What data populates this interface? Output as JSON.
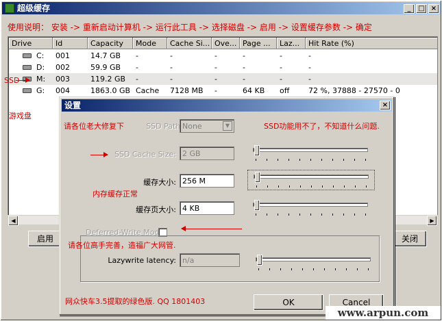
{
  "window": {
    "title": "超级缓存",
    "minimize_glyph": "_",
    "restore_glyph": "□",
    "close_glyph": "×"
  },
  "instruction": "使用说明： 安装 -> 重新启动计算机 -> 运行此工具 -> 选择磁盘 -> 启用 -> 设置缓存参数 -> 确定",
  "table": {
    "columns": [
      "Drive",
      "Id",
      "Capacity",
      "Mode",
      "Cache Si...",
      "Ove...",
      "Page ...",
      "Laz...",
      "Hit Rate (%)"
    ],
    "rows": [
      [
        "C:",
        "001",
        "14.7 GB",
        "-",
        "-",
        "-",
        "-",
        "-",
        "-"
      ],
      [
        "D:",
        "002",
        "59.9 GB",
        "-",
        "-",
        "-",
        "-",
        "-",
        "-"
      ],
      [
        "M:",
        "003",
        "119.2 GB",
        "-",
        "-",
        "-",
        "-",
        "-",
        "-"
      ],
      [
        "G:",
        "004",
        "1863.0 GB",
        "Cache",
        "7128 MB",
        "-",
        "64 KB",
        "off",
        "72 %, 37888 - 27570 - 0"
      ]
    ]
  },
  "annotations": {
    "ssd": "SSD",
    "game_disk": "游戏盘",
    "ask_fix": "请各位老大修复下",
    "ssd_broken": "SSD功能用不了，不知道什么问题.",
    "mem_ok": "内存缓存正常",
    "ask_improve": "请各位高手完善，造福广大网管.",
    "credit": "网众快车3.5提取的绿色版.   QQ 1801403"
  },
  "main_buttons": {
    "enable": "启用",
    "close": "关闭"
  },
  "dialog": {
    "title": "设置",
    "close_glyph": "×",
    "ssd_path_label": "SSD Path:",
    "ssd_path_value": "None",
    "ssd_cache_label": "SSD Cache Size:",
    "ssd_cache_value": "2 GB",
    "cache_size_label": "缓存大小:",
    "cache_size_value": "256 M",
    "page_size_label": "缓存页大小:",
    "page_size_value": "4 KB",
    "deferred_label": "Deferred-Write Mode",
    "lazywrite_label": "Lazywrite latency:",
    "lazywrite_value": "n/a",
    "ok": "OK",
    "cancel": "Cancel"
  },
  "watermark": "www.arpun.com",
  "colors": {
    "annotation": "#d40000",
    "title_bar": "#0a246a",
    "window": "#d4d0c8"
  }
}
